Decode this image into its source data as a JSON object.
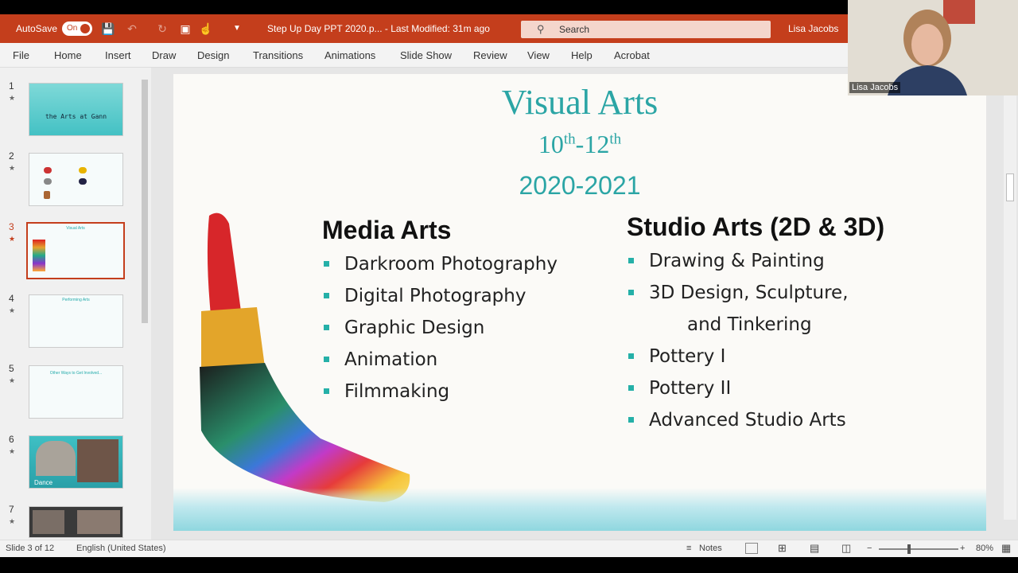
{
  "titlebar": {
    "autosave_label": "AutoSave",
    "autosave_state": "On",
    "doc_title": "Step Up Day PPT 2020.p...  -  Last Modified: 31m ago",
    "search_placeholder": "Search",
    "user_name": "Lisa Jacobs"
  },
  "ribbon": {
    "tabs": [
      "File",
      "Home",
      "Insert",
      "Draw",
      "Design",
      "Transitions",
      "Animations",
      "Slide Show",
      "Review",
      "View",
      "Help",
      "Acrobat"
    ]
  },
  "thumbnails": [
    {
      "num": "1",
      "title": "the Arts at Gann"
    },
    {
      "num": "2",
      "title": ""
    },
    {
      "num": "3",
      "title": "Visual Arts"
    },
    {
      "num": "4",
      "title": "Performing Arts"
    },
    {
      "num": "5",
      "title": "Other Ways to Get Involved..."
    },
    {
      "num": "6",
      "title": "Dance"
    },
    {
      "num": "7",
      "title": ""
    }
  ],
  "slide": {
    "title": "Visual Arts",
    "grade_base1": "10",
    "grade_sup1": "th",
    "grade_sep": "-",
    "grade_base2": "12",
    "grade_sup2": "th",
    "year": "2020-2021",
    "left_heading": "Media Arts",
    "left_items": [
      "Darkroom Photography",
      "Digital Photography",
      "Graphic Design",
      "Animation",
      "Filmmaking"
    ],
    "right_heading": "Studio Arts (2D & 3D)",
    "right_items": [
      "Drawing & Painting",
      "3D Design, Sculpture,",
      "and Tinkering",
      "Pottery I",
      "Pottery II",
      "Advanced Studio Arts"
    ]
  },
  "statusbar": {
    "slide_counter": "Slide 3 of 12",
    "language": "English (United States)",
    "notes_label": "Notes",
    "zoom": "80%"
  },
  "video": {
    "participant_name": "Lisa Jacobs"
  },
  "colors": {
    "accent": "#c43e1c",
    "teal": "#2ba5a5"
  }
}
